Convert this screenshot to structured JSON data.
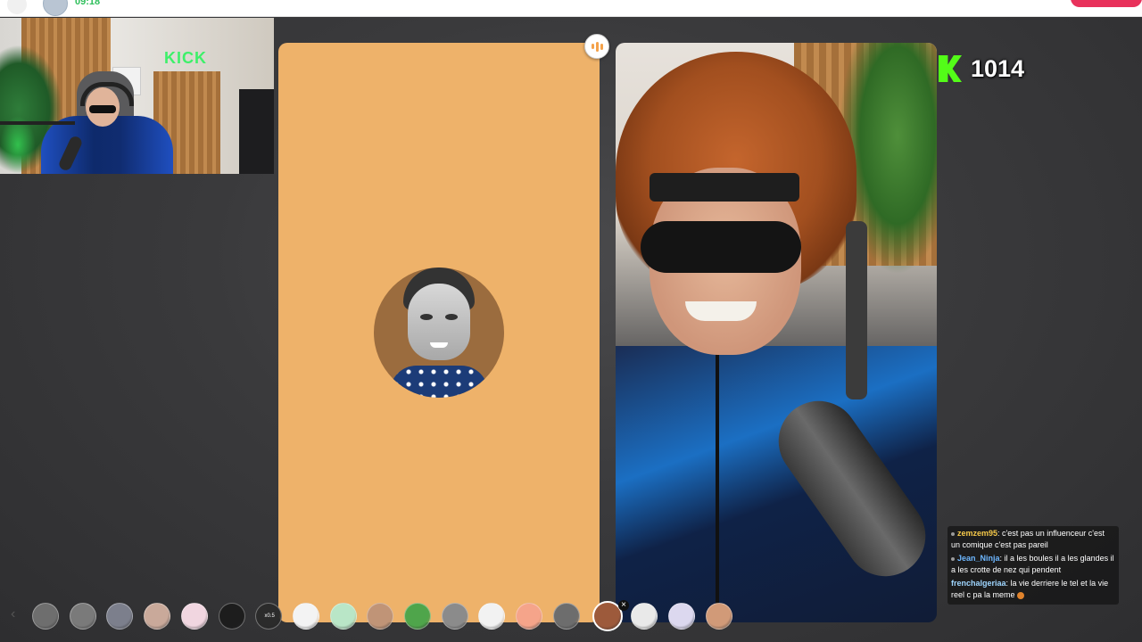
{
  "top_bar": {
    "call_timer": "09:18"
  },
  "stream_overlay": {
    "kick_sign": "KICK",
    "viewer_count": "1014"
  },
  "chat": [
    {
      "user": "zemzem95",
      "text": ": c'est pas un influenceur c'est un comique c'est pas pareil"
    },
    {
      "user": "Jean_Ninja",
      "text": ": il a les boules il a les glandes il a les crotte de nez qui pendent"
    },
    {
      "user": "frenchalgeriaa",
      "text": ": la vie derriere le tel et la vie reel c pa la meme"
    }
  ],
  "filters": [
    {
      "name": "filter-gray-face",
      "color": "#6e6e6e"
    },
    {
      "name": "filter-settings",
      "color": "#7a7a7a"
    },
    {
      "name": "filter-blur",
      "color": "#7c7f8c"
    },
    {
      "name": "filter-beige",
      "color": "#c9a99a"
    },
    {
      "name": "filter-blush-face",
      "color": "#f1d6e0"
    },
    {
      "name": "filter-devil-mask",
      "color": "#1d1d1d"
    },
    {
      "name": "filter-speed",
      "color": "#2b2b2b",
      "label": "x0.5"
    },
    {
      "name": "filter-stars",
      "color": "#f3f3f3"
    },
    {
      "name": "filter-green-face",
      "color": "#b9e6c7"
    },
    {
      "name": "filter-beard",
      "color": "#c09477"
    },
    {
      "name": "filter-green-helmet",
      "color": "#4fa54b"
    },
    {
      "name": "filter-gray-cat",
      "color": "#8b8b8b"
    },
    {
      "name": "filter-white-face",
      "color": "#f2f2f2"
    },
    {
      "name": "filter-peach",
      "color": "#f5a48a"
    },
    {
      "name": "filter-horse",
      "color": "#6d6d6d"
    },
    {
      "name": "filter-hair-wig",
      "color": "#9d5a3b",
      "selected": true
    },
    {
      "name": "filter-sad-face",
      "color": "#e9e9e9"
    },
    {
      "name": "filter-lavender-face",
      "color": "#dcd8ef"
    },
    {
      "name": "filter-real-face",
      "color": "#d19a78"
    }
  ]
}
